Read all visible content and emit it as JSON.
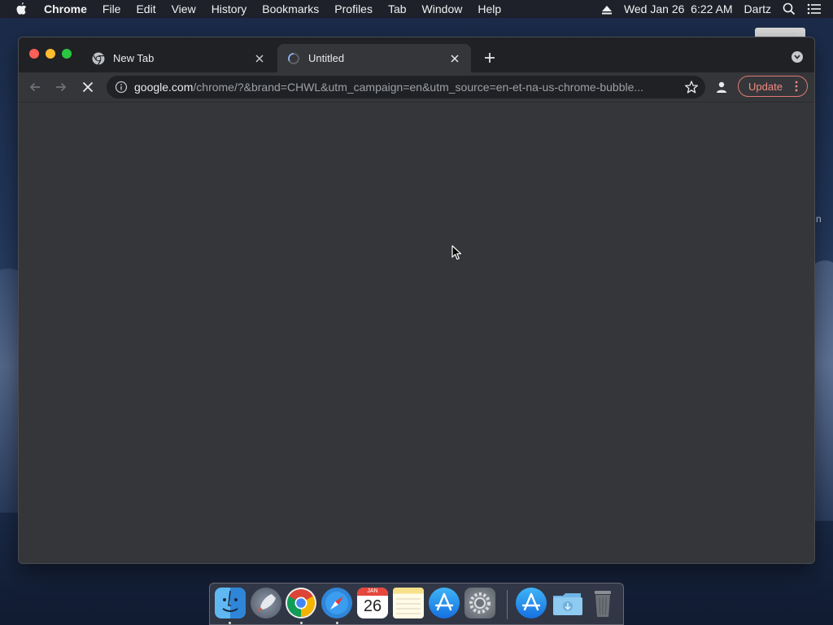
{
  "menubar": {
    "app_name": "Chrome",
    "items": [
      "File",
      "Edit",
      "View",
      "History",
      "Bookmarks",
      "Profiles",
      "Tab",
      "Window",
      "Help"
    ],
    "datetime": "Wed Jan 26  6:22 AM",
    "user": "Dartz"
  },
  "tabs": [
    {
      "title": "New Tab",
      "icon": "chrome-icon",
      "active": false
    },
    {
      "title": "Untitled",
      "icon": "loading-spinner-icon",
      "active": true
    }
  ],
  "toolbar": {
    "url_host": "google.com",
    "url_rest": "/chrome/?&brand=CHWL&utm_campaign=en&utm_source=en-et-na-us-chrome-bubble...",
    "update_label": "Update"
  },
  "desktop": {
    "side_text": "n"
  },
  "dock": {
    "calendar_month": "JAN",
    "calendar_day": "26",
    "apps": [
      "finder",
      "launchpad",
      "chrome",
      "safari",
      "calendar",
      "notes",
      "app-store",
      "system-preferences",
      "app-store-downloads",
      "downloads-folder",
      "trash"
    ]
  },
  "colors": {
    "tabstrip": "#202124",
    "toolbar": "#35363a",
    "update_accent": "#f28b82"
  }
}
